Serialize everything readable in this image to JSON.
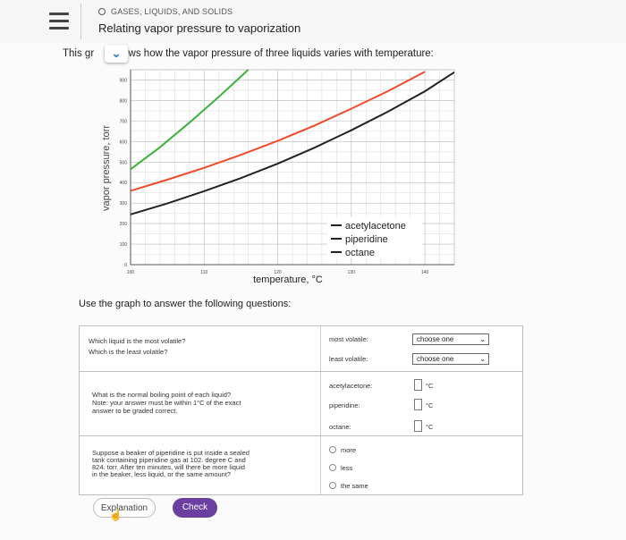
{
  "header": {
    "topic": "GASES, LIQUIDS, AND SOLIDS",
    "subtitle": "Relating vapor pressure to vaporization"
  },
  "intro": {
    "prefix": "This gr",
    "suffix": "ows how the vapor pressure of three liquids varies with temperature:"
  },
  "chart_data": {
    "type": "line",
    "xlabel": "temperature, °C",
    "ylabel": "vapor pressure, torr",
    "xlim": [
      100,
      144
    ],
    "ylim": [
      0,
      950
    ],
    "x_ticks": [
      "100",
      "110",
      "120",
      "130",
      "140"
    ],
    "y_ticks": [
      "0",
      "100",
      "200",
      "300",
      "400",
      "500",
      "600",
      "700",
      "800",
      "900"
    ],
    "grid": true,
    "legend_position": "bottom-right",
    "series": [
      {
        "name": "acetylacetone",
        "color": "#f04a2a",
        "x": [
          100,
          105,
          110,
          115,
          120,
          125,
          130,
          135,
          140
        ],
        "y": [
          360,
          414,
          472,
          535,
          603,
          678,
          760,
          846,
          940
        ]
      },
      {
        "name": "piperidine",
        "color": "#3cb23c",
        "x": [
          100,
          104,
          108,
          112,
          116
        ],
        "y": [
          465,
          572,
          692,
          818,
          950
        ]
      },
      {
        "name": "octane",
        "color": "#222222",
        "x": [
          100,
          105,
          110,
          115,
          120,
          125,
          130,
          135,
          140,
          144
        ],
        "y": [
          245,
          298,
          358,
          422,
          492,
          570,
          655,
          746,
          845,
          938
        ]
      }
    ]
  },
  "questions_intro": "Use the graph to answer the following questions:",
  "q1": {
    "text_1": "Which liquid is the most volatile?",
    "text_2": "Which is the least volatile?",
    "most_label": "most volatile:",
    "least_label": "least volatile:",
    "most_value": "choose one",
    "least_value": "choose one"
  },
  "q2": {
    "text_1": "What is the normal boiling point of each liquid?",
    "text_2": "Note: your answer must be within 1°C of the exact",
    "text_3": "answer to be graded correct.",
    "liquids": [
      "acetylacetone:",
      "piperidine:",
      "octane:"
    ],
    "unit": "°C"
  },
  "q3": {
    "text_1": "Suppose a beaker of piperidine is put inside a sealed",
    "text_2": "tank containing piperidine gas at 102. degree C and",
    "text_3": "824. torr. After ten minutes, will there be more liquid",
    "text_4": "in the beaker, less liquid, or the same amount?",
    "options": [
      "more",
      "less",
      "the same"
    ]
  },
  "buttons": {
    "explanation": "Explanation",
    "check": "Check"
  }
}
